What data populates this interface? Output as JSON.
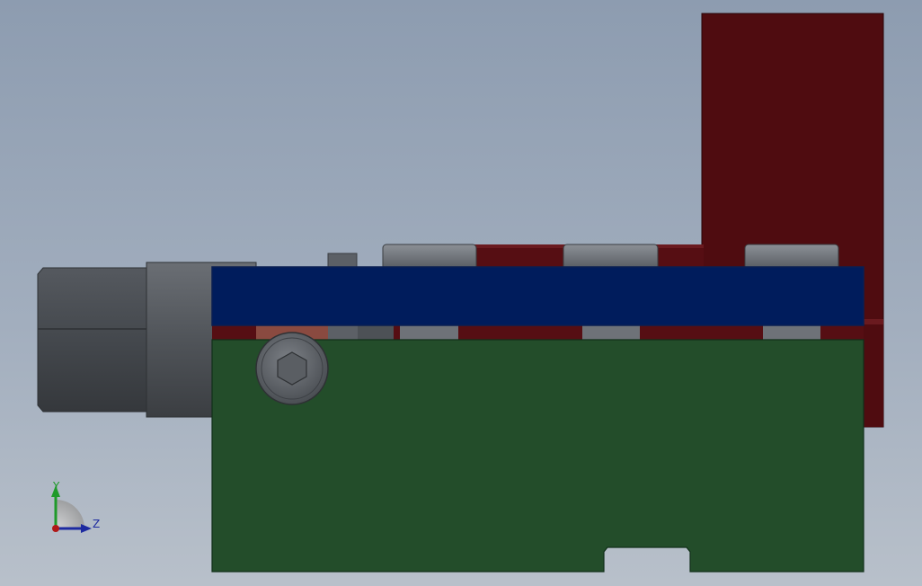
{
  "window": {
    "background_top": "#8d9cb0",
    "background_bottom": "#b8c0ca"
  },
  "model": {
    "colors": {
      "dark_red": "#4f0c10",
      "red_mid": "#5a1015",
      "navy": "#001c5c",
      "navy_edge": "#0a2a73",
      "green": "#234d2a",
      "green_edge": "#11301a",
      "steel_dark": "#464a50",
      "steel_mid": "#5b5f66",
      "steel_light": "#8a8e94",
      "copper": "#8a4a40"
    },
    "parts": [
      {
        "name": "bracket-vertical-plate",
        "color": "dark-red"
      },
      {
        "name": "bracket-horizontal-plate",
        "color": "dark-red"
      },
      {
        "name": "top-cover-plate",
        "color": "navy"
      },
      {
        "name": "base-block",
        "color": "green"
      },
      {
        "name": "hex-nut",
        "color": "steel"
      },
      {
        "name": "cap-screw-row",
        "color": "steel",
        "count": 3
      },
      {
        "name": "socket-head-screw",
        "color": "steel"
      }
    ]
  },
  "triad": {
    "y_label": "Y",
    "z_label": "Z",
    "y_color": "#1f9a2a",
    "z_color": "#1d2aa0",
    "x_color": "#b01818"
  }
}
